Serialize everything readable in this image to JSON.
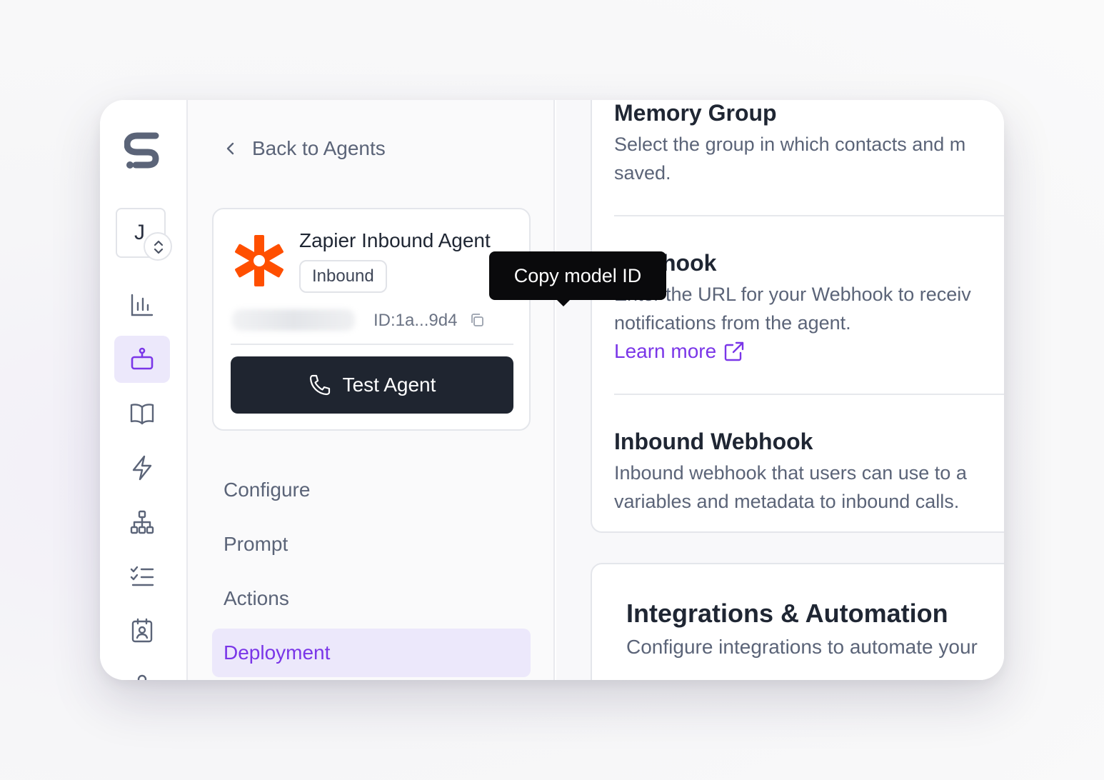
{
  "colors": {
    "accent": "#7a36e8",
    "accent_bg": "#ece8fb",
    "button_dark": "#1f2530",
    "text_primary": "#1f2633",
    "text_secondary": "#5b6478",
    "zapier_orange": "#ff4f00"
  },
  "sidebar": {
    "logo_icon": "brand-s-logo-icon",
    "account": {
      "initial": "J",
      "switch_icon": "chevron-up-down-icon"
    },
    "items": [
      {
        "icon": "bar-chart-icon",
        "active": false
      },
      {
        "icon": "robot-agent-icon",
        "active": true
      },
      {
        "icon": "book-open-icon",
        "active": false
      },
      {
        "icon": "lightning-icon",
        "active": false
      },
      {
        "icon": "hierarchy-network-icon",
        "active": false
      },
      {
        "icon": "checklist-icon",
        "active": false
      },
      {
        "icon": "contact-calendar-icon",
        "active": false
      }
    ]
  },
  "panel": {
    "back_label": "Back to Agents",
    "agent": {
      "name": "Zapier Inbound Agent",
      "badge": "Inbound",
      "id_label": "ID:1a...9d4",
      "test_button": "Test Agent"
    },
    "tooltip": "Copy model ID",
    "nav": [
      {
        "label": "Configure",
        "active": false
      },
      {
        "label": "Prompt",
        "active": false
      },
      {
        "label": "Actions",
        "active": false
      },
      {
        "label": "Deployment",
        "active": true
      }
    ]
  },
  "main": {
    "memory_group": {
      "title": "Memory Group",
      "desc_line1": "Select the group in which contacts and m",
      "desc_line2": "saved."
    },
    "webhook": {
      "title": "Webhook",
      "desc_line1": "Enter the URL for your Webhook to receiv",
      "desc_line2": "notifications from the agent.",
      "learn_more": "Learn more"
    },
    "inbound_webhook": {
      "title": "Inbound Webhook",
      "desc_line1": "Inbound webhook that users can use to a",
      "desc_line2": "variables and metadata to inbound calls."
    },
    "integrations": {
      "title": "Integrations & Automation",
      "desc": "Configure integrations to automate your"
    }
  }
}
